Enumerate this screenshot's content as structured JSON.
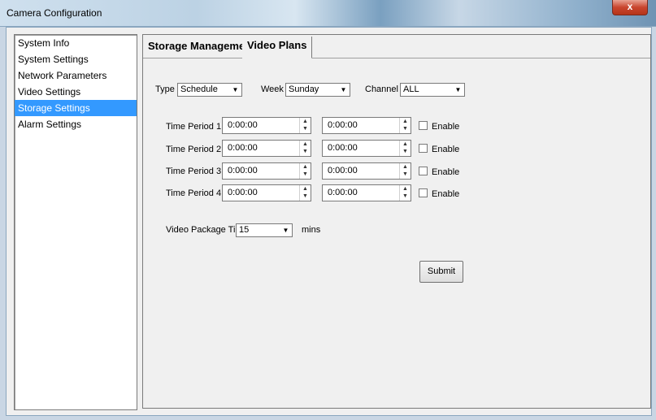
{
  "window": {
    "title": "Camera Configuration",
    "close_label": "x"
  },
  "nav": {
    "items": [
      {
        "label": "System Info"
      },
      {
        "label": "System Settings"
      },
      {
        "label": "Network Parameters"
      },
      {
        "label": "Video Settings"
      },
      {
        "label": "Storage Settings",
        "selected": true
      },
      {
        "label": "Alarm Settings"
      }
    ]
  },
  "tabs": {
    "storage_management": "Storage Management",
    "video_plans": "Video Plans"
  },
  "filters": {
    "type_label": "Type",
    "type_value": "Schedule",
    "week_label": "Week",
    "week_value": "Sunday",
    "channel_label": "Channel",
    "channel_value": "ALL"
  },
  "periods": [
    {
      "label": "Time Period 1",
      "start": "0:00:00",
      "end": "0:00:00",
      "enable_label": "Enable"
    },
    {
      "label": "Time Period 2",
      "start": "0:00:00",
      "end": "0:00:00",
      "enable_label": "Enable"
    },
    {
      "label": "Time Period 3",
      "start": "0:00:00",
      "end": "0:00:00",
      "enable_label": "Enable"
    },
    {
      "label": "Time Period 4",
      "start": "0:00:00",
      "end": "0:00:00",
      "enable_label": "Enable"
    }
  ],
  "package": {
    "label": "Video Package Time",
    "value": "15",
    "unit": "mins"
  },
  "submit_label": "Submit",
  "colors": {
    "selection": "#3399ff",
    "close_button": "#c9452e"
  }
}
